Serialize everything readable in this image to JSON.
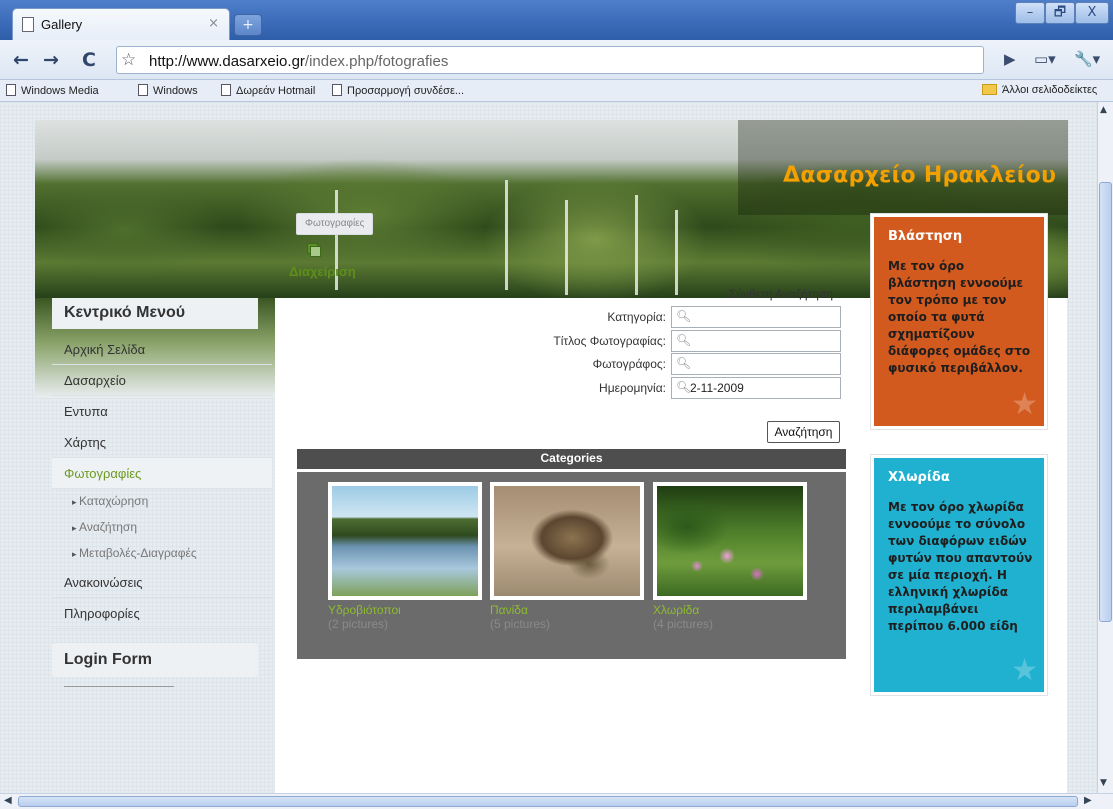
{
  "browser": {
    "tab_title": "Gallery",
    "tab_close": "×",
    "new_tab": "+",
    "url_domain": "http://www.dasarxeio.gr",
    "url_path": "/index.php/fotografies",
    "window_buttons": {
      "minimize": "–",
      "maximize": "🗗",
      "close": "X"
    },
    "bookmarks": [
      "Windows Media",
      "Windows",
      "Δωρεάν Hotmail",
      "Προσαρμογή συνδέσε..."
    ],
    "other_bookmarks": "Άλλοι σελιδοδείκτες"
  },
  "site": {
    "title": "Δασαρχείο Ηρακλείου"
  },
  "menu": {
    "title": "Κεντρικό Μενού",
    "items": [
      {
        "label": "Αρχική Σελίδα"
      },
      {
        "label": "Δασαρχείο"
      },
      {
        "label": "Εντυπα"
      },
      {
        "label": "Χάρτης"
      },
      {
        "label": "Φωτογραφίες"
      }
    ],
    "subitems": [
      "Καταχώρηση",
      "Αναζήτηση",
      "Μεταβολές-Διαγραφές"
    ],
    "items_after": [
      {
        "label": "Ανακοινώσεις"
      },
      {
        "label": "Πληροφορίες"
      }
    ]
  },
  "login": {
    "title": "Login Form"
  },
  "content": {
    "breadcrumb": "Φωτογραφίες",
    "admin_label": "Διαχείριση",
    "advanced_search": "Σύνθετη Αναζήτηση",
    "fields": {
      "category_label": "Κατηγορία:",
      "title_label": "Τίτλος Φωτογραφίας:",
      "photographer_label": "Φωτογράφος:",
      "date_label": "Ημερομηνία:",
      "date_value": "2-11-2009"
    },
    "search_button": "Αναζήτηση",
    "categories_header": "Categories",
    "categories": [
      {
        "name": "Υδροβιότοποι",
        "count": "(2 pictures)"
      },
      {
        "name": "Πανίδα",
        "count": "(5 pictures)"
      },
      {
        "name": "Χλωρίδα",
        "count": "(4 pictures)"
      }
    ]
  },
  "sidebar_right": {
    "box1": {
      "title": "Βλάστηση",
      "text": "Με τον όρο βλάστηση εννοούμε τον τρόπο με τον οποίο τα φυτά σχηματίζουν διάφορες ομάδες στο φυσικό περιβάλλον."
    },
    "box2": {
      "title": "Χλωρίδα",
      "text": "Με τον όρο χλωρίδα εννοούμε το σύνολο των διαφόρων ειδών φυτών που απαντούν σε μία περιοχή. Η ελληνική χλωρίδα περιλαμβάνει περίπου 6.000 είδη"
    }
  },
  "colors": {
    "accent_green": "#6c9a1f",
    "site_title_orange": "#f2a100",
    "box_orange": "#d35a1e",
    "box_blue": "#1fb1cf"
  }
}
